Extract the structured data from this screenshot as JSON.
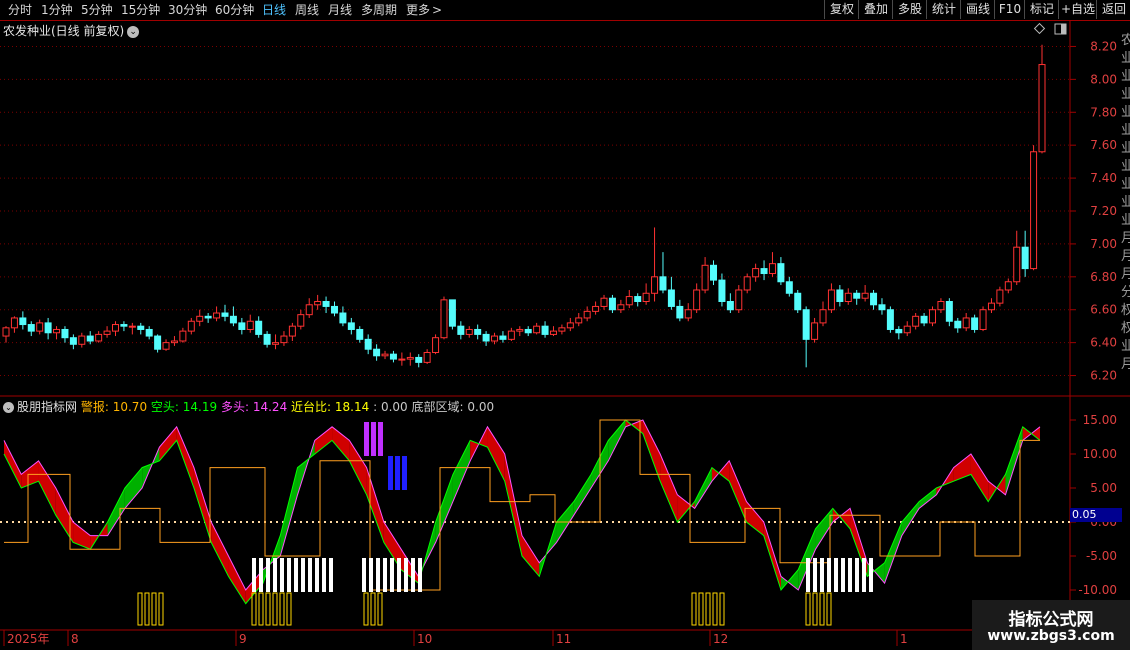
{
  "toolbar": {
    "periods": [
      "分时",
      "1分钟",
      "5分钟",
      "15分钟",
      "30分钟",
      "60分钟",
      "日线",
      "周线",
      "月线",
      "多周期",
      "更多"
    ],
    "active_period": "日线",
    "more_arrow": ">",
    "right_buttons": [
      "复权",
      "叠加",
      "多股",
      "统计",
      "画线",
      "F10",
      "标记",
      "+自选",
      "返回"
    ]
  },
  "chart": {
    "title": "农发种业(日线 前复权)",
    "price_ticks": [
      "8.20",
      "8.00",
      "7.80",
      "7.60",
      "7.40",
      "7.20",
      "7.00",
      "6.80",
      "6.60",
      "6.40",
      "6.20"
    ],
    "price_range": [
      6.1,
      8.3
    ],
    "up_color": "#ff3232",
    "down_color": "#54fcfc",
    "candles": [
      [
        6.44,
        6.49,
        6.4,
        6.5
      ],
      [
        6.49,
        6.55,
        6.46,
        6.56
      ],
      [
        6.55,
        6.51,
        6.48,
        6.59
      ],
      [
        6.51,
        6.47,
        6.44,
        6.53
      ],
      [
        6.47,
        6.52,
        6.45,
        6.54
      ],
      [
        6.52,
        6.46,
        6.42,
        6.55
      ],
      [
        6.46,
        6.48,
        6.42,
        6.5
      ],
      [
        6.48,
        6.43,
        6.4,
        6.5
      ],
      [
        6.43,
        6.39,
        6.36,
        6.45
      ],
      [
        6.39,
        6.44,
        6.37,
        6.46
      ],
      [
        6.44,
        6.41,
        6.39,
        6.47
      ],
      [
        6.41,
        6.45,
        6.4,
        6.47
      ],
      [
        6.45,
        6.47,
        6.43,
        6.5
      ],
      [
        6.47,
        6.51,
        6.44,
        6.53
      ],
      [
        6.51,
        6.5,
        6.47,
        6.53
      ],
      [
        6.5,
        6.5,
        6.45,
        6.52
      ],
      [
        6.5,
        6.48,
        6.45,
        6.52
      ],
      [
        6.48,
        6.44,
        6.42,
        6.5
      ],
      [
        6.44,
        6.36,
        6.34,
        6.45
      ],
      [
        6.36,
        6.4,
        6.35,
        6.42
      ],
      [
        6.4,
        6.41,
        6.38,
        6.44
      ],
      [
        6.41,
        6.47,
        6.4,
        6.49
      ],
      [
        6.47,
        6.53,
        6.45,
        6.55
      ],
      [
        6.53,
        6.56,
        6.5,
        6.6
      ],
      [
        6.56,
        6.55,
        6.52,
        6.58
      ],
      [
        6.55,
        6.58,
        6.53,
        6.62
      ],
      [
        6.58,
        6.56,
        6.53,
        6.63
      ],
      [
        6.56,
        6.52,
        6.5,
        6.62
      ],
      [
        6.52,
        6.48,
        6.45,
        6.55
      ],
      [
        6.48,
        6.53,
        6.46,
        6.57
      ],
      [
        6.53,
        6.45,
        6.43,
        6.56
      ],
      [
        6.45,
        6.39,
        6.37,
        6.47
      ],
      [
        6.39,
        6.4,
        6.36,
        6.45
      ],
      [
        6.4,
        6.44,
        6.38,
        6.47
      ],
      [
        6.44,
        6.5,
        6.41,
        6.52
      ],
      [
        6.5,
        6.57,
        6.48,
        6.6
      ],
      [
        6.57,
        6.63,
        6.55,
        6.67
      ],
      [
        6.63,
        6.65,
        6.6,
        6.69
      ],
      [
        6.65,
        6.62,
        6.58,
        6.68
      ],
      [
        6.62,
        6.58,
        6.56,
        6.65
      ],
      [
        6.58,
        6.52,
        6.5,
        6.62
      ],
      [
        6.52,
        6.48,
        6.45,
        6.55
      ],
      [
        6.48,
        6.42,
        6.4,
        6.5
      ],
      [
        6.42,
        6.36,
        6.33,
        6.45
      ],
      [
        6.36,
        6.32,
        6.29,
        6.39
      ],
      [
        6.32,
        6.33,
        6.3,
        6.35
      ],
      [
        6.33,
        6.3,
        6.28,
        6.35
      ],
      [
        6.3,
        6.3,
        6.26,
        6.34
      ],
      [
        6.3,
        6.31,
        6.26,
        6.34
      ],
      [
        6.31,
        6.28,
        6.25,
        6.33
      ],
      [
        6.28,
        6.34,
        6.27,
        6.36
      ],
      [
        6.34,
        6.43,
        6.33,
        6.45
      ],
      [
        6.43,
        6.66,
        6.42,
        6.68
      ],
      [
        6.66,
        6.5,
        6.48,
        6.66
      ],
      [
        6.5,
        6.45,
        6.42,
        6.53
      ],
      [
        6.45,
        6.48,
        6.43,
        6.5
      ],
      [
        6.48,
        6.45,
        6.42,
        6.51
      ],
      [
        6.45,
        6.41,
        6.38,
        6.47
      ],
      [
        6.41,
        6.44,
        6.39,
        6.46
      ],
      [
        6.44,
        6.42,
        6.4,
        6.47
      ],
      [
        6.42,
        6.47,
        6.41,
        6.49
      ],
      [
        6.47,
        6.48,
        6.44,
        6.5
      ],
      [
        6.48,
        6.46,
        6.44,
        6.5
      ],
      [
        6.46,
        6.5,
        6.45,
        6.52
      ],
      [
        6.5,
        6.45,
        6.43,
        6.53
      ],
      [
        6.45,
        6.47,
        6.44,
        6.5
      ],
      [
        6.47,
        6.49,
        6.45,
        6.51
      ],
      [
        6.49,
        6.52,
        6.47,
        6.55
      ],
      [
        6.52,
        6.55,
        6.5,
        6.58
      ],
      [
        6.55,
        6.59,
        6.53,
        6.62
      ],
      [
        6.59,
        6.62,
        6.57,
        6.65
      ],
      [
        6.62,
        6.67,
        6.6,
        6.69
      ],
      [
        6.67,
        6.6,
        6.58,
        6.69
      ],
      [
        6.6,
        6.63,
        6.58,
        6.66
      ],
      [
        6.63,
        6.68,
        6.61,
        6.72
      ],
      [
        6.68,
        6.65,
        6.62,
        6.7
      ],
      [
        6.65,
        6.7,
        6.63,
        6.76
      ],
      [
        6.7,
        6.8,
        6.65,
        7.1
      ],
      [
        6.8,
        6.72,
        6.7,
        6.95
      ],
      [
        6.72,
        6.62,
        6.6,
        6.8
      ],
      [
        6.62,
        6.55,
        6.53,
        6.66
      ],
      [
        6.55,
        6.6,
        6.53,
        6.64
      ],
      [
        6.6,
        6.72,
        6.58,
        6.76
      ],
      [
        6.72,
        6.87,
        6.7,
        6.92
      ],
      [
        6.87,
        6.78,
        6.75,
        6.9
      ],
      [
        6.78,
        6.65,
        6.62,
        6.82
      ],
      [
        6.65,
        6.6,
        6.58,
        6.7
      ],
      [
        6.6,
        6.72,
        6.58,
        6.75
      ],
      [
        6.72,
        6.8,
        6.7,
        6.82
      ],
      [
        6.8,
        6.85,
        6.77,
        6.88
      ],
      [
        6.85,
        6.82,
        6.78,
        6.9
      ],
      [
        6.82,
        6.88,
        6.8,
        6.95
      ],
      [
        6.88,
        6.77,
        6.75,
        6.92
      ],
      [
        6.77,
        6.7,
        6.68,
        6.8
      ],
      [
        6.7,
        6.6,
        6.58,
        6.72
      ],
      [
        6.6,
        6.42,
        6.25,
        6.62
      ],
      [
        6.42,
        6.52,
        6.4,
        6.55
      ],
      [
        6.52,
        6.6,
        6.5,
        6.65
      ],
      [
        6.6,
        6.72,
        6.58,
        6.76
      ],
      [
        6.72,
        6.65,
        6.62,
        6.75
      ],
      [
        6.65,
        6.7,
        6.63,
        6.73
      ],
      [
        6.7,
        6.67,
        6.63,
        6.72
      ],
      [
        6.67,
        6.7,
        6.65,
        6.75
      ],
      [
        6.7,
        6.63,
        6.6,
        6.72
      ],
      [
        6.63,
        6.6,
        6.57,
        6.67
      ],
      [
        6.6,
        6.48,
        6.46,
        6.62
      ],
      [
        6.48,
        6.46,
        6.42,
        6.5
      ],
      [
        6.46,
        6.5,
        6.44,
        6.53
      ],
      [
        6.5,
        6.56,
        6.48,
        6.58
      ],
      [
        6.56,
        6.52,
        6.5,
        6.58
      ],
      [
        6.52,
        6.6,
        6.5,
        6.62
      ],
      [
        6.6,
        6.65,
        6.58,
        6.67
      ],
      [
        6.65,
        6.53,
        6.5,
        6.67
      ],
      [
        6.53,
        6.49,
        6.46,
        6.55
      ],
      [
        6.49,
        6.55,
        6.47,
        6.58
      ],
      [
        6.55,
        6.48,
        6.46,
        6.57
      ],
      [
        6.48,
        6.6,
        6.47,
        6.62
      ],
      [
        6.6,
        6.64,
        6.58,
        6.67
      ],
      [
        6.64,
        6.72,
        6.62,
        6.74
      ],
      [
        6.72,
        6.77,
        6.7,
        6.79
      ],
      [
        6.77,
        6.98,
        6.75,
        7.08
      ],
      [
        6.98,
        6.85,
        6.8,
        7.08
      ],
      [
        6.85,
        7.56,
        6.84,
        7.6
      ],
      [
        7.56,
        8.09,
        7.55,
        8.21
      ]
    ],
    "date_labels": [
      "2025年",
      "8",
      "9",
      "10",
      "11",
      "12",
      "1"
    ]
  },
  "indicator": {
    "name": "股朋指标网",
    "alarm_label": "警报:",
    "alarm_value": "10.70",
    "short_label": "空头:",
    "short_value": "14.19",
    "long_label": "多头:",
    "long_value": "14.24",
    "ratio_label": "近台比:",
    "ratio_value": "18.14",
    "sep_value": ": 0.00",
    "bottom_label": "底部区域:",
    "bottom_value": "0.00",
    "ticks": [
      "15.00",
      "10.00",
      "5.00",
      "0.00",
      "-5.00",
      "-10.00"
    ],
    "current_value": "0.05",
    "colors": {
      "alarm": "#ffb400",
      "short": "#00ff00",
      "long": "#ff50ff",
      "ratio": "#ffff00",
      "bottom": "#c8c8c8"
    }
  },
  "right_edge_glyphs": [
    "农",
    "业",
    "业",
    "业",
    "业",
    "业",
    "业",
    "业",
    "业",
    "业",
    "业",
    "月",
    "月",
    "月",
    "分",
    "权",
    "权",
    "业",
    "月"
  ],
  "watermark": {
    "title": "指标公式网",
    "url": "www.zbgs3.com"
  }
}
